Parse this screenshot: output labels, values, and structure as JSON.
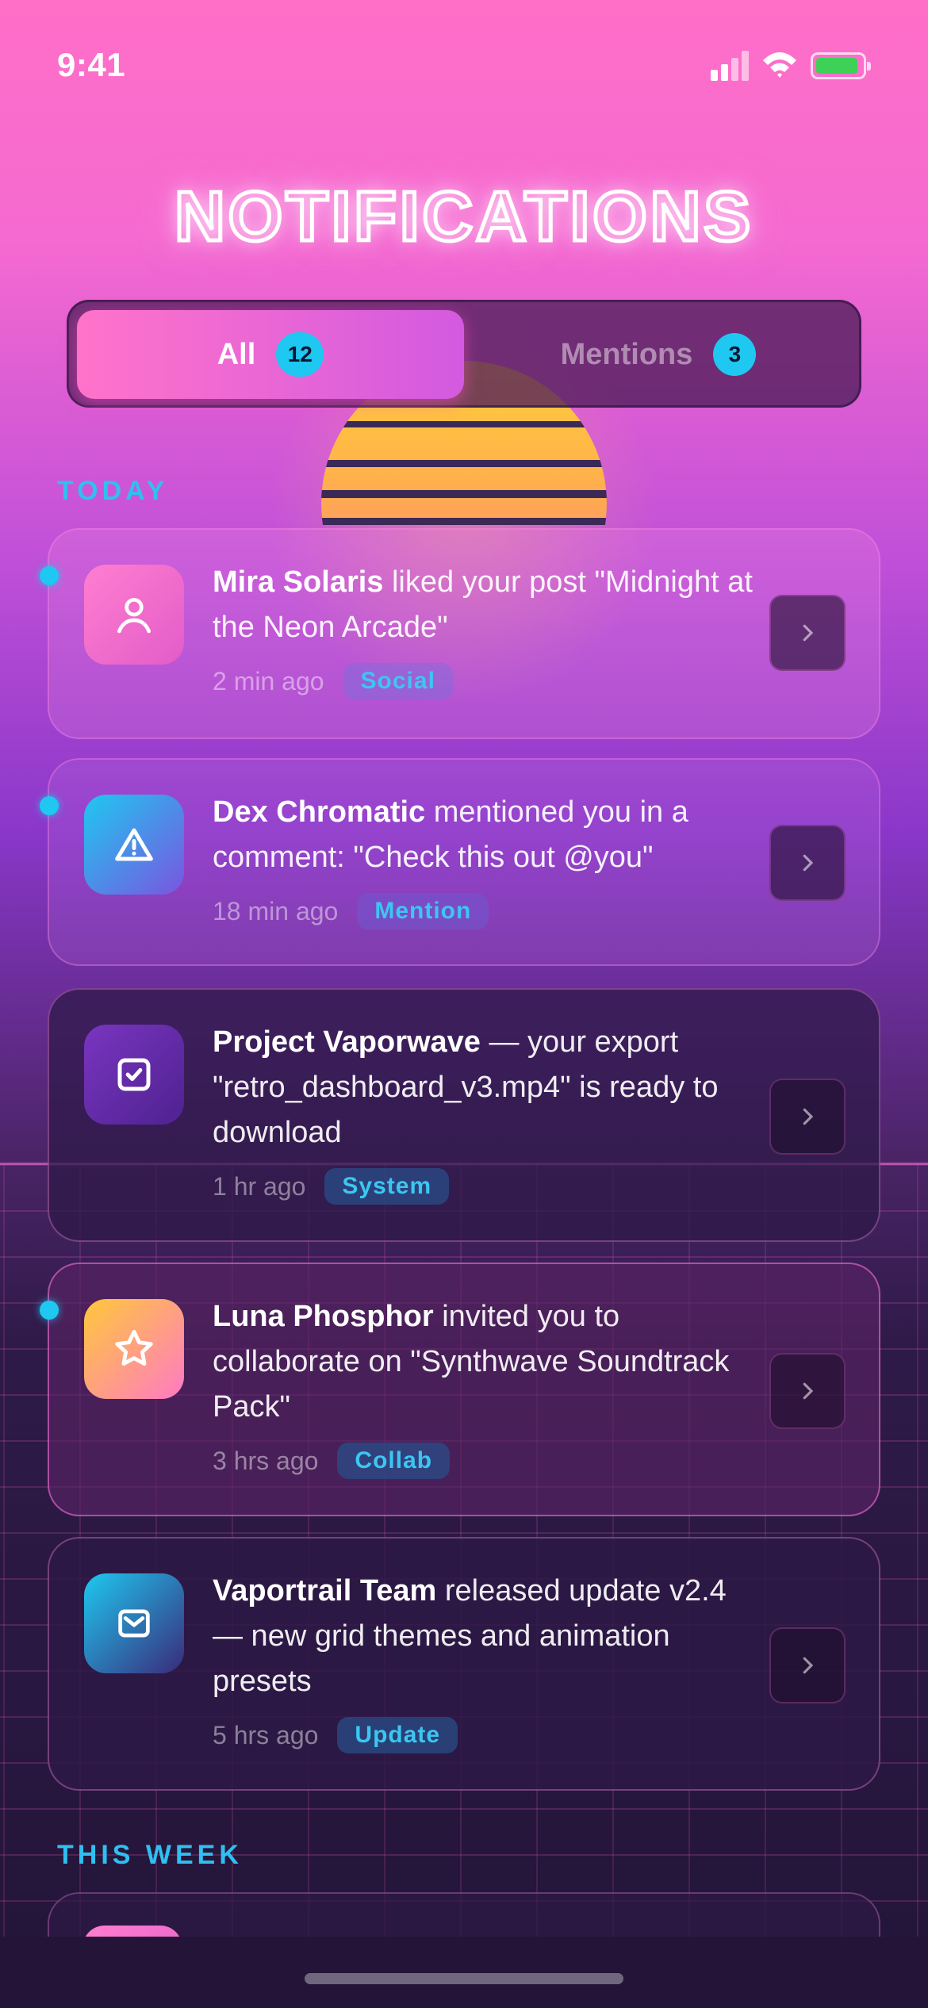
{
  "status_bar": {
    "time": "9:41"
  },
  "title": "NOTIFICATIONS",
  "tabs": [
    {
      "label": "All",
      "count": "12",
      "active": true
    },
    {
      "label": "Mentions",
      "count": "3",
      "active": false
    }
  ],
  "sections": {
    "today": "TODAY",
    "this_week": "THIS WEEK"
  },
  "notifications": [
    {
      "actor": "Mira Solaris",
      "text": " liked your post \"Midnight at the Neon Arcade\"",
      "time": "2 min ago",
      "tag": "Social",
      "unread": true,
      "icon": "user-icon",
      "color": "#ff6fcf"
    },
    {
      "actor": "Dex Chromatic",
      "text": " mentioned you in a comment: \"Check this out @you\"",
      "time": "18 min ago",
      "tag": "Mention",
      "unread": true,
      "icon": "alert-triangle-icon",
      "color": "#1ec8f0"
    },
    {
      "actor": "Project Vaporwave",
      "text": " — your export \"retro_dashboard_v3.mp4\" is ready to download",
      "time": "1 hr ago",
      "tag": "System",
      "unread": false,
      "icon": "check-square-icon",
      "color": "#7a35c0"
    },
    {
      "actor": "Luna Phosphor",
      "text": " invited you to collaborate on \"Synthwave Soundtrack Pack\"",
      "time": "3 hrs ago",
      "tag": "Collab",
      "unread": true,
      "icon": "star-icon",
      "color": "#ffc83a"
    },
    {
      "actor": "Vaportrail Team",
      "text": " released update v2.4 — new grid themes and animation presets",
      "time": "5 hrs ago",
      "tag": "Update",
      "unread": false,
      "icon": "mail-icon",
      "color": "#1ec8f0"
    }
  ],
  "colors": {
    "accent": "#1ec8f0",
    "pink": "#ff73c9",
    "purple": "#d35ae0"
  }
}
